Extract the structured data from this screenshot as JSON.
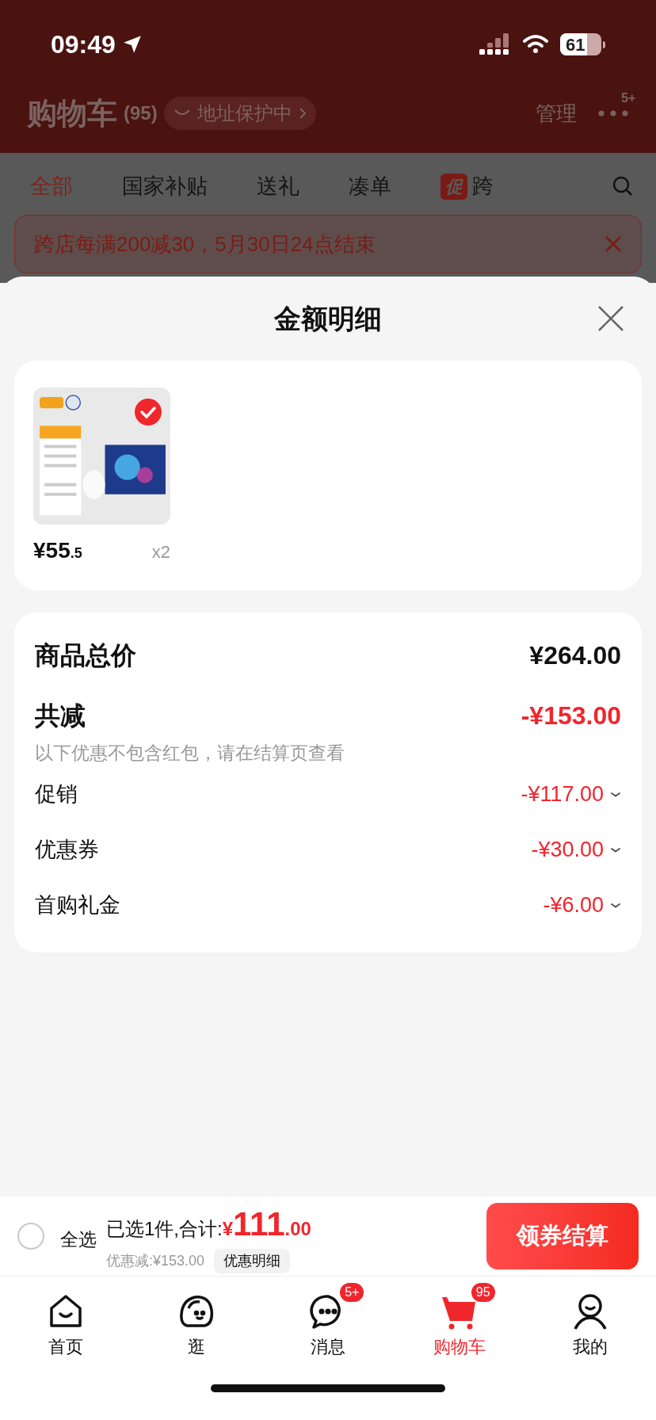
{
  "status_bar": {
    "time": "09:49",
    "battery": "61"
  },
  "header": {
    "title": "购物车",
    "count": "(95)",
    "address_chip": "地址保护中",
    "manage": "管理",
    "more_badge": "5+"
  },
  "filter_tabs": [
    {
      "label": "全部",
      "selected": true
    },
    {
      "label": "国家补贴",
      "selected": false
    },
    {
      "label": "送礼",
      "selected": false
    },
    {
      "label": "凑单",
      "selected": false
    },
    {
      "label": "跨",
      "selected": false,
      "badge": "促"
    }
  ],
  "promo_banner": {
    "text": "跨店每满200减30，5月30日24点结束"
  },
  "sheet": {
    "title": "金额明细",
    "items": [
      {
        "price_main": "¥55",
        "price_decimal": ".5",
        "quantity": "x2",
        "selected": true
      }
    ],
    "summary": {
      "total_label": "商品总价",
      "total": "¥264.00",
      "discount_label": "共减",
      "discount": "-¥153.00",
      "note": "以下优惠不包含红包，请在结算页查看",
      "breakdown": [
        {
          "label": "促销",
          "amount": "-¥117.00"
        },
        {
          "label": "优惠券",
          "amount": "-¥30.00"
        },
        {
          "label": "首购礼金",
          "amount": "-¥6.00"
        }
      ]
    }
  },
  "checkout_bar": {
    "select_all": {
      "label": "全选",
      "checked": false
    },
    "selected_text": "已选1件,合计:",
    "currency": "¥",
    "total_int": "111",
    "total_dec": ".00",
    "discount_text": "优惠减:¥153.00",
    "detail_button": "优惠明细",
    "checkout_button": "领券结算"
  },
  "tab_bar": [
    {
      "label": "首页",
      "kind": "home",
      "selected": false
    },
    {
      "label": "逛",
      "kind": "browse",
      "selected": false
    },
    {
      "label": "消息",
      "kind": "message",
      "selected": false,
      "badge": "5+"
    },
    {
      "label": "购物车",
      "kind": "cart",
      "selected": true,
      "badge": "95"
    },
    {
      "label": "我的",
      "kind": "profile",
      "selected": false
    }
  ]
}
